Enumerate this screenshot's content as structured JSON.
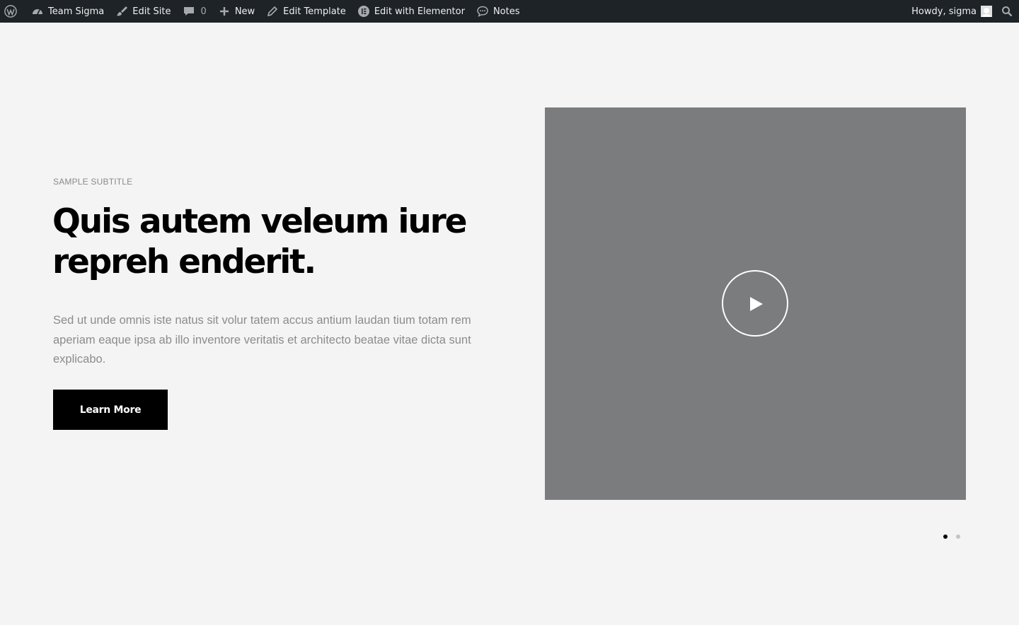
{
  "adminbar": {
    "site_name": "Team Sigma",
    "edit_site": "Edit Site",
    "comments_count": "0",
    "new_label": "New",
    "edit_template": "Edit Template",
    "edit_elementor": "Edit with Elementor",
    "notes": "Notes",
    "howdy": "Howdy, sigma",
    "background": "#1d2327",
    "text_color": "#f0f0f1",
    "icons": [
      "wordpress-icon",
      "dashboard-icon",
      "brush-icon",
      "comment-icon",
      "plus-icon",
      "pencil-icon",
      "elementor-icon",
      "notes-icon",
      "avatar",
      "search-icon"
    ]
  },
  "hero": {
    "subtitle": "SAMPLE SUBTITLE",
    "headline": "Quis autem veleum iure repreh enderit.",
    "body": "Sed ut unde omnis iste natus sit volur tatem accus antium laudan tium totam rem aperiam eaque ipsa ab illo inventore veritatis et architecto beatae vitae dicta sunt explicabo.",
    "cta_label": "Learn More",
    "video_placeholder_color": "#7b7c7e"
  },
  "slider": {
    "total_slides": 2,
    "active_slide": 1
  }
}
